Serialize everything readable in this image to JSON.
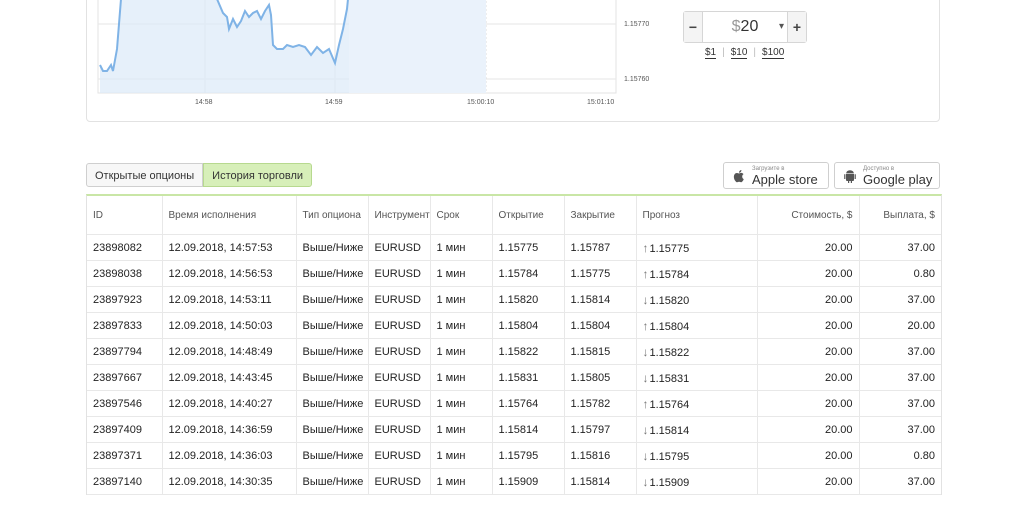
{
  "chart": {
    "y_ticks": [
      "1.15770",
      "1.15760"
    ],
    "x_ticks": [
      "14:58",
      "14:59",
      "15:00:10",
      "15:01:10"
    ]
  },
  "amount": {
    "minus": "−",
    "plus": "+",
    "currency": "$",
    "value": "20",
    "caret": "▾",
    "presets": [
      "$1",
      "$10",
      "$100"
    ]
  },
  "tabs": [
    {
      "label": "Открытые опционы",
      "active": false
    },
    {
      "label": "История торговли",
      "active": true
    }
  ],
  "stores": {
    "apple": {
      "small": "Загрузите в",
      "big": "Apple store",
      "icon": "apple-icon"
    },
    "google": {
      "small": "Доступно в",
      "big": "Google play",
      "icon": "android-icon"
    }
  },
  "table": {
    "headers": [
      "ID",
      "Время исполнения",
      "Тип опциона",
      "Инструмент",
      "Срок",
      "Открытие",
      "Закрытие",
      "Прогноз",
      "Стоимость, $",
      "Выплата, $"
    ],
    "rows": [
      {
        "id": "23898082",
        "time": "12.09.2018, 14:57:53",
        "type": "Выше/Ниже",
        "instrument": "EURUSD",
        "term": "1 мин",
        "open": "1.15775",
        "close": "1.15787",
        "dir": "↑",
        "forecast": "1.15775",
        "cost": "20.00",
        "payout": "37.00"
      },
      {
        "id": "23898038",
        "time": "12.09.2018, 14:56:53",
        "type": "Выше/Ниже",
        "instrument": "EURUSD",
        "term": "1 мин",
        "open": "1.15784",
        "close": "1.15775",
        "dir": "↑",
        "forecast": "1.15784",
        "cost": "20.00",
        "payout": "0.80"
      },
      {
        "id": "23897923",
        "time": "12.09.2018, 14:53:11",
        "type": "Выше/Ниже",
        "instrument": "EURUSD",
        "term": "1 мин",
        "open": "1.15820",
        "close": "1.15814",
        "dir": "↓",
        "forecast": "1.15820",
        "cost": "20.00",
        "payout": "37.00"
      },
      {
        "id": "23897833",
        "time": "12.09.2018, 14:50:03",
        "type": "Выше/Ниже",
        "instrument": "EURUSD",
        "term": "1 мин",
        "open": "1.15804",
        "close": "1.15804",
        "dir": "↑",
        "forecast": "1.15804",
        "cost": "20.00",
        "payout": "20.00"
      },
      {
        "id": "23897794",
        "time": "12.09.2018, 14:48:49",
        "type": "Выше/Ниже",
        "instrument": "EURUSD",
        "term": "1 мин",
        "open": "1.15822",
        "close": "1.15815",
        "dir": "↓",
        "forecast": "1.15822",
        "cost": "20.00",
        "payout": "37.00"
      },
      {
        "id": "23897667",
        "time": "12.09.2018, 14:43:45",
        "type": "Выше/Ниже",
        "instrument": "EURUSD",
        "term": "1 мин",
        "open": "1.15831",
        "close": "1.15805",
        "dir": "↓",
        "forecast": "1.15831",
        "cost": "20.00",
        "payout": "37.00"
      },
      {
        "id": "23897546",
        "time": "12.09.2018, 14:40:27",
        "type": "Выше/Ниже",
        "instrument": "EURUSD",
        "term": "1 мин",
        "open": "1.15764",
        "close": "1.15782",
        "dir": "↑",
        "forecast": "1.15764",
        "cost": "20.00",
        "payout": "37.00"
      },
      {
        "id": "23897409",
        "time": "12.09.2018, 14:36:59",
        "type": "Выше/Ниже",
        "instrument": "EURUSD",
        "term": "1 мин",
        "open": "1.15814",
        "close": "1.15797",
        "dir": "↓",
        "forecast": "1.15814",
        "cost": "20.00",
        "payout": "37.00"
      },
      {
        "id": "23897371",
        "time": "12.09.2018, 14:36:03",
        "type": "Выше/Ниже",
        "instrument": "EURUSD",
        "term": "1 мин",
        "open": "1.15795",
        "close": "1.15816",
        "dir": "↓",
        "forecast": "1.15795",
        "cost": "20.00",
        "payout": "0.80"
      },
      {
        "id": "23897140",
        "time": "12.09.2018, 14:30:35",
        "type": "Выше/Ниже",
        "instrument": "EURUSD",
        "term": "1 мин",
        "open": "1.15909",
        "close": "1.15814",
        "dir": "↓",
        "forecast": "1.15909",
        "cost": "20.00",
        "payout": "37.00"
      }
    ]
  }
}
